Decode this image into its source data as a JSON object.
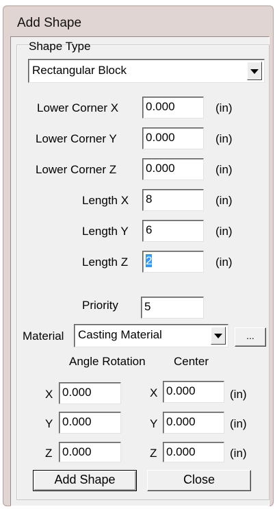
{
  "window": {
    "title": "Add Shape"
  },
  "shape_type": {
    "label": "Shape Type",
    "selected": "Rectangular Block"
  },
  "fields": {
    "lower_x": {
      "label": "Lower Corner X",
      "value": "0.000",
      "unit": "(in)"
    },
    "lower_y": {
      "label": "Lower Corner Y",
      "value": "0.000",
      "unit": "(in)"
    },
    "lower_z": {
      "label": "Lower Corner Z",
      "value": "0.000",
      "unit": "(in)"
    },
    "length_x": {
      "label": "Length X",
      "value": "8",
      "unit": "(in)"
    },
    "length_y": {
      "label": "Length Y",
      "value": "6",
      "unit": "(in)"
    },
    "length_z": {
      "label": "Length Z",
      "value": "2",
      "unit": "(in)"
    },
    "priority": {
      "label": "Priority",
      "value": "5"
    }
  },
  "material": {
    "label": "Material",
    "selected": "Casting Material",
    "browse_label": "..."
  },
  "rotation": {
    "angle_header": "Angle Rotation",
    "center_header": "Center",
    "angle": [
      {
        "axis": "X",
        "value": "0.000"
      },
      {
        "axis": "Y",
        "value": "0.000"
      },
      {
        "axis": "Z",
        "value": "0.000"
      }
    ],
    "center": [
      {
        "axis": "X",
        "value": "0.000",
        "unit": "(in)"
      },
      {
        "axis": "Y",
        "value": "0.000",
        "unit": "(in)"
      },
      {
        "axis": "Z",
        "value": "0.000",
        "unit": "(in)"
      }
    ]
  },
  "buttons": {
    "add_shape": "Add Shape",
    "close": "Close"
  }
}
